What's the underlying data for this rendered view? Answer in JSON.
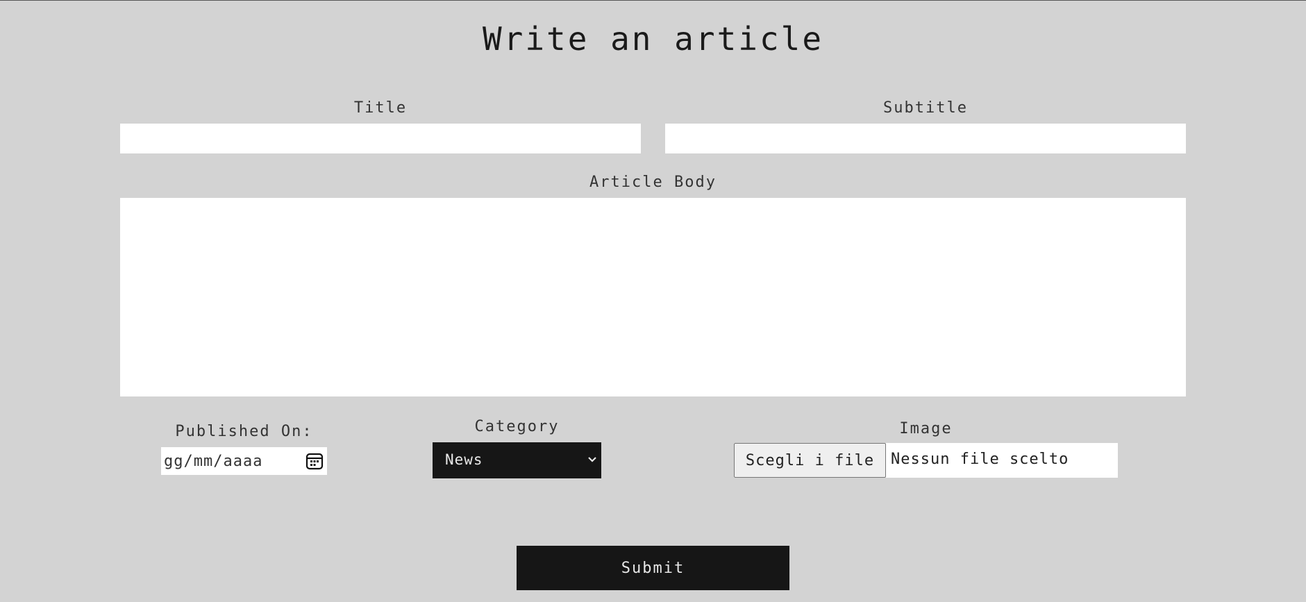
{
  "page": {
    "title": "Write an article"
  },
  "form": {
    "title_label": "Title",
    "title_value": "",
    "subtitle_label": "Subtitle",
    "subtitle_value": "",
    "body_label": "Article Body",
    "body_value": "",
    "published_label": "Published On:",
    "published_placeholder": "gg/mm/aaaa",
    "category_label": "Category",
    "category_selected": "News",
    "image_label": "Image",
    "file_button_label": "Scegli i file",
    "file_status": "Nessun file scelto",
    "submit_label": "Submit"
  },
  "icons": {
    "date_picker": "calendar-icon",
    "select_arrow": "chevron-down-icon"
  },
  "colors": {
    "background": "#d3d3d3",
    "dark": "#161616",
    "field": "#ffffff"
  }
}
